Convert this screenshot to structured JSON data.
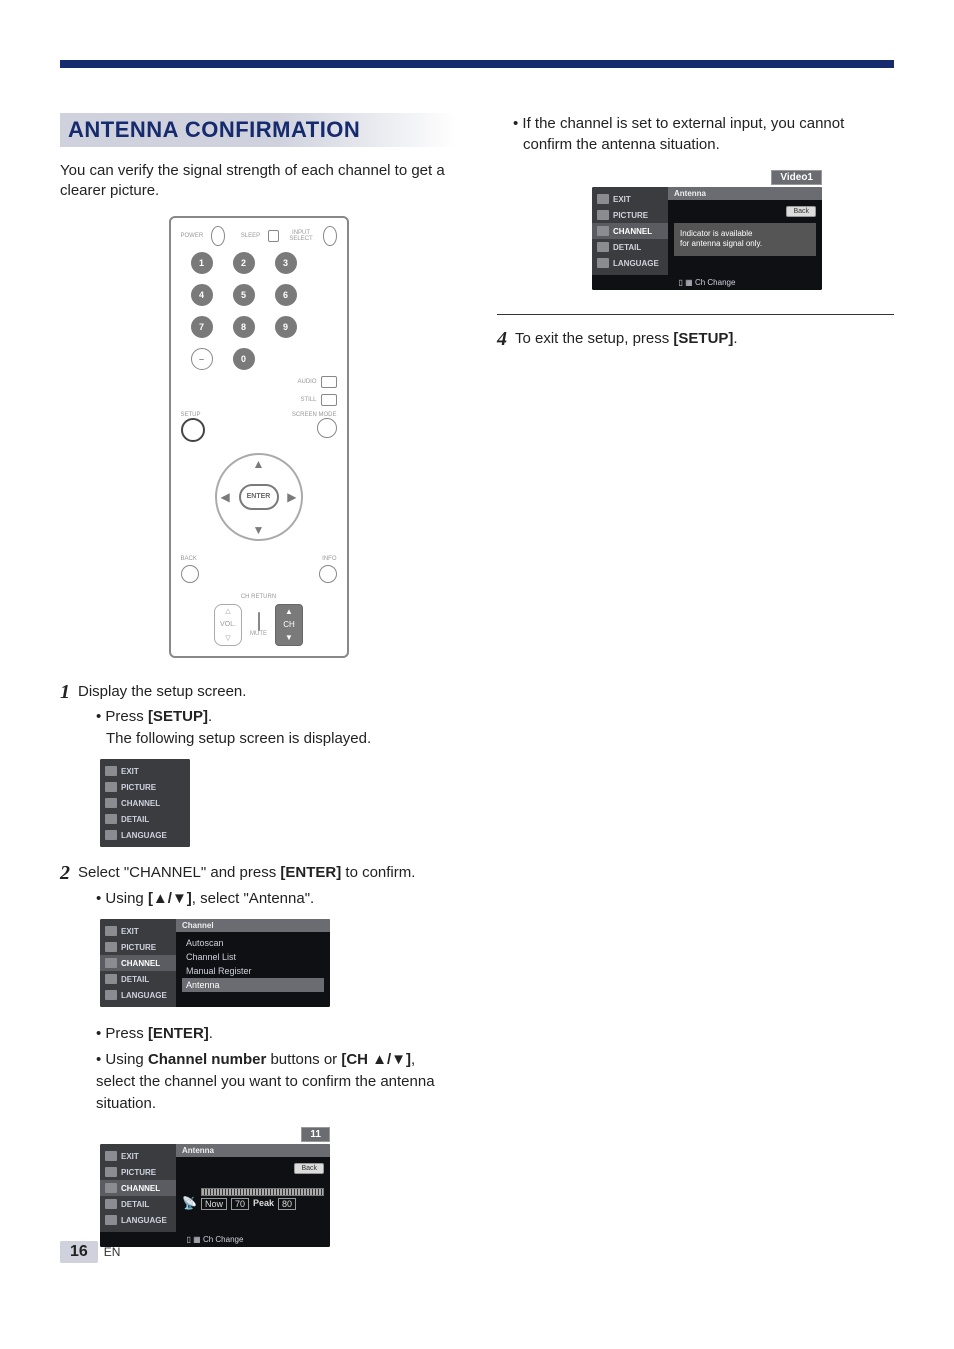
{
  "page_number": "16",
  "page_lang": "EN",
  "title": "ANTENNA CONFIRMATION",
  "intro": "You can verify the signal strength of each channel to get a clearer picture.",
  "remote": {
    "power_label": "POWER",
    "sleep_label": "SLEEP",
    "input_label": "INPUT SELECT",
    "audio_label": "AUDIO",
    "still_label": "STILL",
    "screen_label": "SCREEN MODE",
    "setup_label": "SETUP",
    "back_label": "BACK",
    "info_label": "INFO",
    "enter_label": "ENTER",
    "chreturn_label": "CH RETURN",
    "vol_label": "VOL.",
    "mute_label": "MUTE",
    "ch_label": "CH",
    "digits": [
      "1",
      "2",
      "3",
      "4",
      "5",
      "6",
      "7",
      "8",
      "9",
      "–",
      "0"
    ]
  },
  "steps": {
    "s1": {
      "num": "1",
      "text": "Display the setup screen.",
      "sub1_prefix": "• Press ",
      "sub1_key": "[SETUP]",
      "sub1_suffix": ".",
      "sub2": "The following setup screen is displayed."
    },
    "s2": {
      "num": "2",
      "text_a": "Select \"CHANNEL\" and press ",
      "text_key": "[ENTER]",
      "text_b": " to confirm.",
      "sub1_prefix": "• Using ",
      "sub1_key": "[▲/▼]",
      "sub1_suffix": ", select \"Antenna\".",
      "sub2_prefix": "• Press ",
      "sub2_key": "[ENTER]",
      "sub2_suffix": ".",
      "sub3_a": "• Using ",
      "sub3_key1": "Channel number",
      "sub3_b": " buttons or ",
      "sub3_key2": "[CH ▲/▼]",
      "sub3_c": ", select the channel you want to confirm the antenna situation."
    },
    "s4": {
      "num": "4",
      "text_a": "To exit the setup, press ",
      "text_key": "[SETUP]",
      "text_b": "."
    }
  },
  "osd": {
    "side_items": [
      "EXIT",
      "PICTURE",
      "CHANNEL",
      "DETAIL",
      "LANGUAGE"
    ],
    "channel_menu": {
      "title": "Channel",
      "items": [
        "Autoscan",
        "Channel List",
        "Manual Register",
        "Antenna"
      ],
      "highlight_index": 3
    },
    "antenna_screen": {
      "title": "Antenna",
      "channel_badge": "11",
      "back": "Back",
      "now": "Now",
      "now_val": "70",
      "peak": "Peak",
      "peak_val": "80",
      "footer": "Ch Change"
    },
    "video_screen": {
      "title": "Antenna",
      "channel_badge": "Video1",
      "back": "Back",
      "msg_line1": "Indicator is available",
      "msg_line2": "for antenna signal only.",
      "footer": "Ch Change"
    }
  },
  "right_note": "• If the channel is set to external input, you cannot confirm the antenna situation."
}
